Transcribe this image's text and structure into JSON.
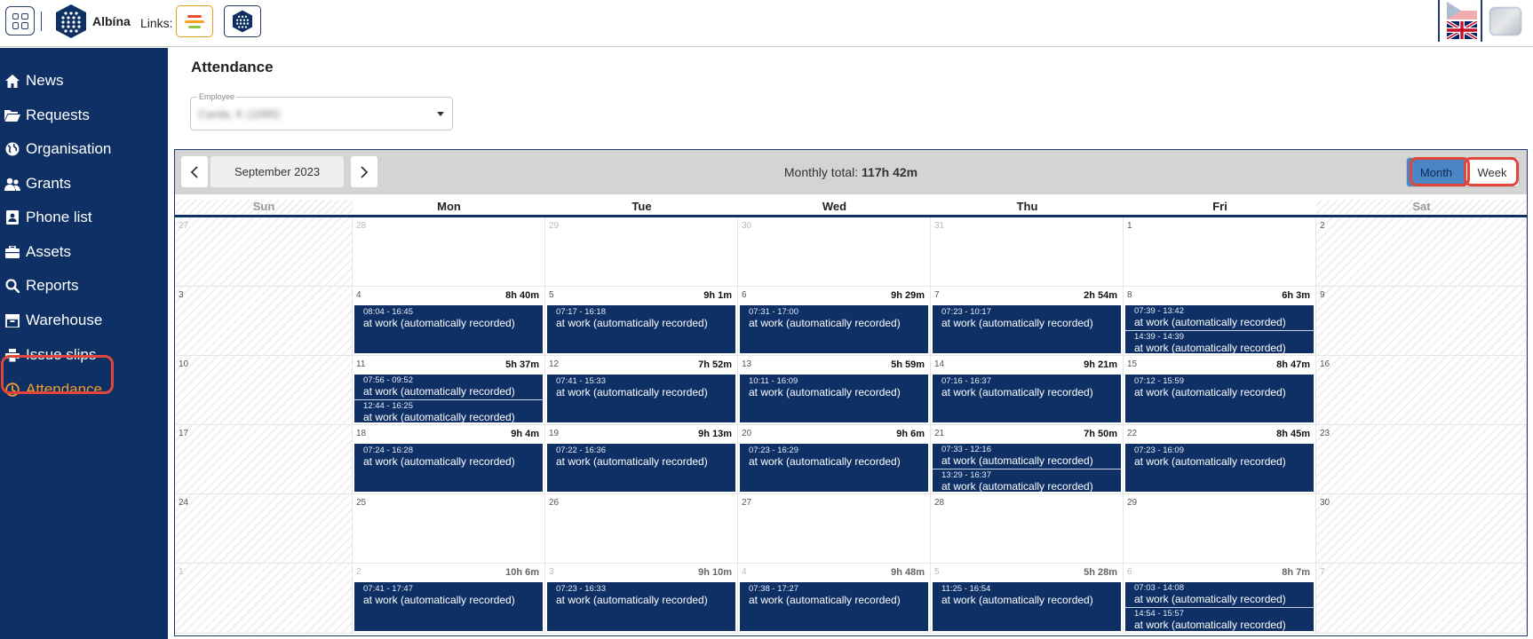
{
  "header": {
    "brand": "Albína",
    "links_label": "Links:"
  },
  "sidebar": {
    "items": [
      {
        "label": "News",
        "icon": "home-icon",
        "active": false
      },
      {
        "label": "Requests",
        "icon": "folder-open-icon",
        "active": false
      },
      {
        "label": "Organisation",
        "icon": "globe-icon",
        "active": false
      },
      {
        "label": "Grants",
        "icon": "users-icon",
        "active": false
      },
      {
        "label": "Phone list",
        "icon": "contact-card-icon",
        "active": false
      },
      {
        "label": "Assets",
        "icon": "briefcase-icon",
        "active": false
      },
      {
        "label": "Reports",
        "icon": "magnifier-icon",
        "active": false
      },
      {
        "label": "Warehouse",
        "icon": "archive-icon",
        "active": false
      },
      {
        "label": "Issue slips",
        "icon": "printer-icon",
        "active": false
      },
      {
        "label": "Attendance",
        "icon": "clock-icon",
        "active": true
      }
    ],
    "accent_color": "#f39b2a",
    "bg_color": "#0e3065"
  },
  "page": {
    "title": "Attendance",
    "employee_label": "Employee",
    "employee_value": "Carda, K (1085)"
  },
  "calendar": {
    "month_label": "September 2023",
    "monthly_total_prefix": "Monthly total: ",
    "monthly_total_value": "117h 42m",
    "view_month": "Month",
    "view_week": "Week",
    "days_of_week": [
      "Sun",
      "Mon",
      "Tue",
      "Wed",
      "Thu",
      "Fri",
      "Sat"
    ],
    "weeks": [
      [
        {
          "day": "27",
          "other": true
        },
        {
          "day": "28",
          "other": true
        },
        {
          "day": "29",
          "other": true
        },
        {
          "day": "30",
          "other": true
        },
        {
          "day": "31",
          "other": true
        },
        {
          "day": "1"
        },
        {
          "day": "2"
        }
      ],
      [
        {
          "day": "3"
        },
        {
          "day": "4",
          "total": "8h 40m",
          "events": [
            {
              "time": "08:04 - 16:45",
              "label": "at work (automatically recorded)"
            }
          ]
        },
        {
          "day": "5",
          "total": "9h 1m",
          "events": [
            {
              "time": "07:17 - 16:18",
              "label": "at work (automatically recorded)"
            }
          ]
        },
        {
          "day": "6",
          "total": "9h 29m",
          "events": [
            {
              "time": "07:31 - 17:00",
              "label": "at work (automatically recorded)"
            }
          ]
        },
        {
          "day": "7",
          "total": "2h 54m",
          "events": [
            {
              "time": "07:23 - 10:17",
              "label": "at work (automatically recorded)"
            }
          ]
        },
        {
          "day": "8",
          "total": "6h 3m",
          "events": [
            {
              "time": "07:39 - 13:42",
              "label": "at work (automatically recorded)"
            },
            {
              "time": "14:39 - 14:39",
              "label": "at work (automatically recorded)"
            }
          ]
        },
        {
          "day": "9"
        }
      ],
      [
        {
          "day": "10"
        },
        {
          "day": "11",
          "total": "5h 37m",
          "events": [
            {
              "time": "07:56 - 09:52",
              "label": "at work (automatically recorded)"
            },
            {
              "time": "12:44 - 16:25",
              "label": "at work (automatically recorded)"
            }
          ]
        },
        {
          "day": "12",
          "total": "7h 52m",
          "events": [
            {
              "time": "07:41 - 15:33",
              "label": "at work (automatically recorded)"
            }
          ]
        },
        {
          "day": "13",
          "total": "5h 59m",
          "events": [
            {
              "time": "10:11 - 16:09",
              "label": "at work (automatically recorded)"
            }
          ]
        },
        {
          "day": "14",
          "total": "9h 21m",
          "events": [
            {
              "time": "07:16 - 16:37",
              "label": "at work (automatically recorded)"
            }
          ]
        },
        {
          "day": "15",
          "total": "8h 47m",
          "events": [
            {
              "time": "07:12 - 15:59",
              "label": "at work (automatically recorded)"
            }
          ]
        },
        {
          "day": "16"
        }
      ],
      [
        {
          "day": "17"
        },
        {
          "day": "18",
          "total": "9h 4m",
          "events": [
            {
              "time": "07:24 - 16:28",
              "label": "at work (automatically recorded)"
            }
          ]
        },
        {
          "day": "19",
          "total": "9h 13m",
          "events": [
            {
              "time": "07:22 - 16:36",
              "label": "at work (automatically recorded)"
            }
          ]
        },
        {
          "day": "20",
          "total": "9h 6m",
          "events": [
            {
              "time": "07:23 - 16:29",
              "label": "at work (automatically recorded)"
            }
          ]
        },
        {
          "day": "21",
          "total": "7h 50m",
          "events": [
            {
              "time": "07:33 - 12:16",
              "label": "at work (automatically recorded)"
            },
            {
              "time": "13:29 - 16:37",
              "label": "at work (automatically recorded)"
            }
          ]
        },
        {
          "day": "22",
          "total": "8h 45m",
          "events": [
            {
              "time": "07:23 - 16:09",
              "label": "at work (automatically recorded)"
            }
          ]
        },
        {
          "day": "23"
        }
      ],
      [
        {
          "day": "24"
        },
        {
          "day": "25"
        },
        {
          "day": "26"
        },
        {
          "day": "27"
        },
        {
          "day": "28"
        },
        {
          "day": "29"
        },
        {
          "day": "30"
        }
      ],
      [
        {
          "day": "1",
          "other": true
        },
        {
          "day": "2",
          "other": true,
          "total": "10h 6m",
          "events": [
            {
              "time": "07:41 - 17:47",
              "label": "at work (automatically recorded)"
            }
          ]
        },
        {
          "day": "3",
          "other": true,
          "total": "9h 10m",
          "events": [
            {
              "time": "07:23 - 16:33",
              "label": "at work (automatically recorded)"
            }
          ]
        },
        {
          "day": "4",
          "other": true,
          "total": "9h 48m",
          "events": [
            {
              "time": "07:38 - 17:27",
              "label": "at work (automatically recorded)"
            }
          ]
        },
        {
          "day": "5",
          "other": true,
          "total": "5h 28m",
          "events": [
            {
              "time": "11:25 - 16:54",
              "label": "at work (automatically recorded)"
            }
          ]
        },
        {
          "day": "6",
          "other": true,
          "total": "8h 7m",
          "events": [
            {
              "time": "07:03 - 14:08",
              "label": "at work (automatically recorded)"
            },
            {
              "time": "14:54 - 15:57",
              "label": "at work (automatically recorded)"
            }
          ]
        },
        {
          "day": "7",
          "other": true
        }
      ]
    ]
  }
}
